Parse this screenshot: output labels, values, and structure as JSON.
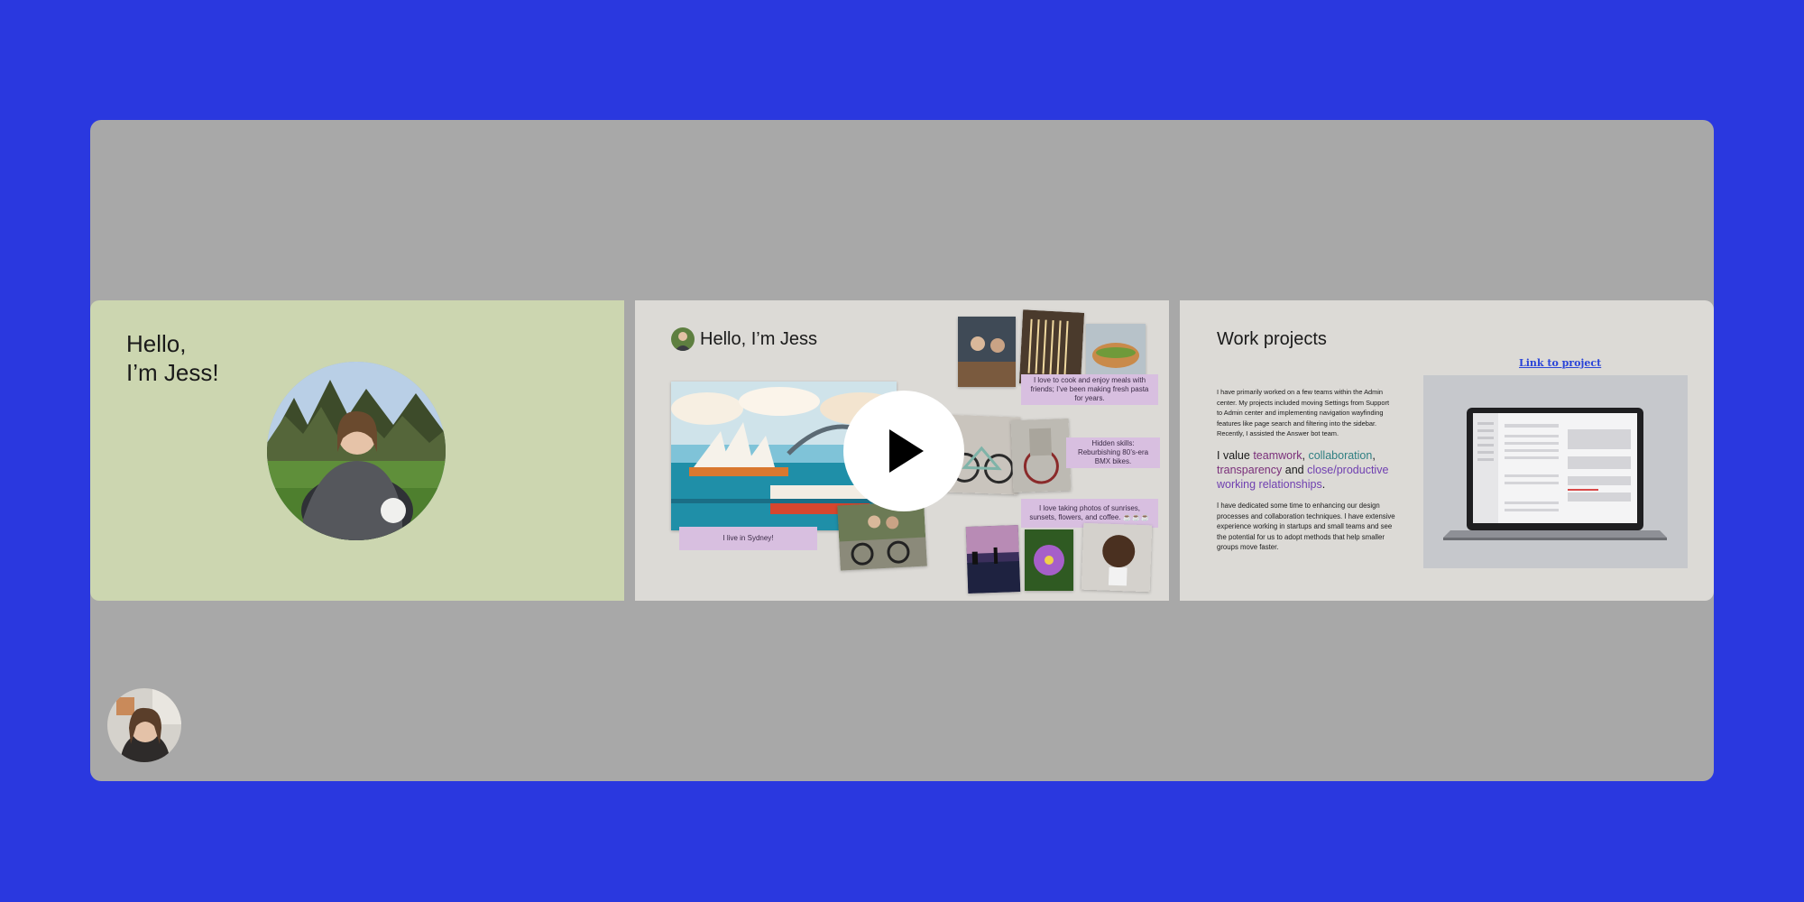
{
  "slides": {
    "intro": {
      "title_line1": "Hello,",
      "title_line2": "I’m Jess!"
    },
    "about": {
      "title": "Hello, I’m Jess",
      "captions": {
        "sydney": "I live in Sydney!",
        "cooking": "I love to cook and enjoy meals with friends; I’ve been making fresh pasta for years.",
        "bikes": "Hidden skills: Reburbishing 80’s-era BMX bikes.",
        "photos": "I love taking photos of sunrises, sunsets, flowers, and coffee. ☕☕☕"
      }
    },
    "work": {
      "title": "Work projects",
      "paragraph1": "I have primarily worked on a few teams within the Admin center. My projects included moving Settings from Support to Admin center and implementing navigation wayfinding features like page search and filtering into the sidebar. Recently, I assisted the Answer bot team.",
      "values_prefix": "I value ",
      "value_teamwork": "teamwork",
      "sep1": ", ",
      "value_collaboration": "collaboration",
      "sep2": ", ",
      "value_transparency": "transparency",
      "sep3": " and ",
      "value_relationships": "close/productive working relationships",
      "values_suffix": ".",
      "paragraph2": "I have dedicated some time to enhancing our design processes and collaboration techniques. I have extensive experience working in startups and small teams and see the potential for us to adopt methods that help smaller groups move faster.",
      "link_label": "Link to project"
    }
  },
  "colors": {
    "background": "#2a38df",
    "stage": "#a8a8a8",
    "slide_intro": "#ccd6b0",
    "slide_neutral": "#dcdad6",
    "caption_bg": "#d8bfe0",
    "link": "#2a44d8"
  },
  "icons": {
    "play": "play-icon"
  }
}
